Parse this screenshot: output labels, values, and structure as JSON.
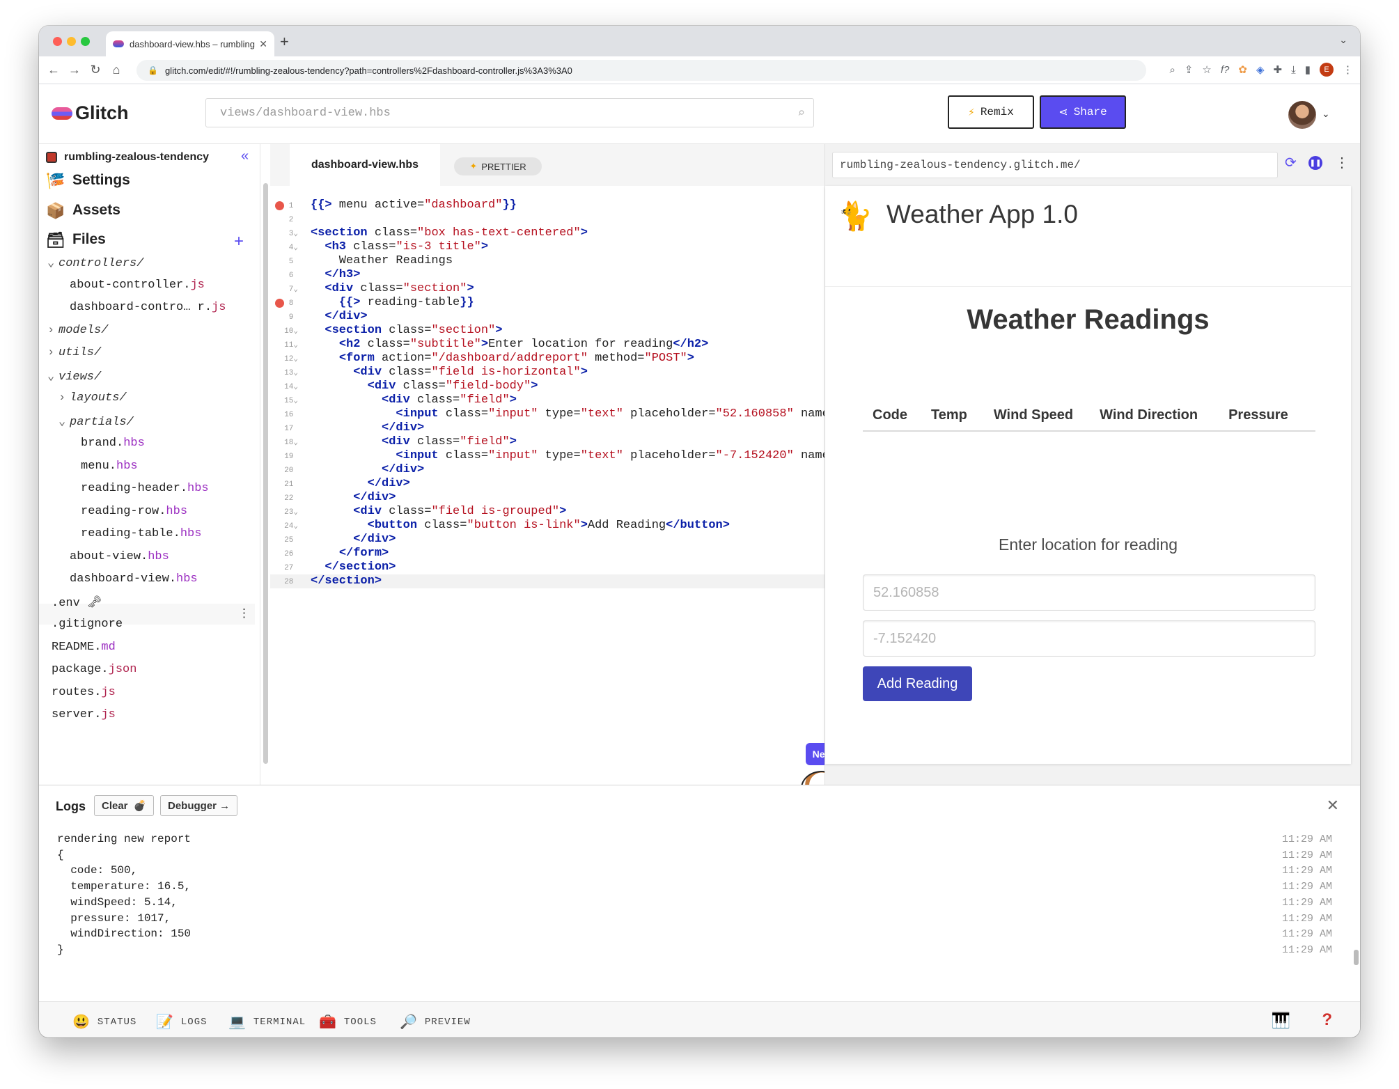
{
  "browser": {
    "tab_title": "dashboard-view.hbs – rumbling-zealous-tendency",
    "url": "glitch.com/edit/#!/rumbling-zealous-tendency?path=controllers%2Fdashboard-controller.js%3A3%3A0",
    "profile_initial": "E"
  },
  "header": {
    "logo": "Glitch",
    "search_placeholder": "views/dashboard-view.hbs",
    "remix_label": "Remix",
    "share_label": "Share"
  },
  "sidebar": {
    "project": "rumbling-zealous-tendency",
    "nav": [
      "Settings",
      "Assets",
      "Files"
    ],
    "files": [
      {
        "indent": 0,
        "type": "dir",
        "open": true,
        "name": "controllers/",
        "ext": ""
      },
      {
        "indent": 1,
        "type": "file",
        "name": "about-controller.",
        "ext": "js"
      },
      {
        "indent": 1,
        "type": "file",
        "name": "dashboard-contro… r.",
        "ext": "js"
      },
      {
        "indent": 0,
        "type": "dir",
        "open": false,
        "name": "models/",
        "ext": ""
      },
      {
        "indent": 0,
        "type": "dir",
        "open": false,
        "name": "utils/",
        "ext": ""
      },
      {
        "indent": 0,
        "type": "dir",
        "open": true,
        "name": "views/",
        "ext": ""
      },
      {
        "indent": 1,
        "type": "dir",
        "open": false,
        "name": "layouts/",
        "ext": ""
      },
      {
        "indent": 1,
        "type": "dir",
        "open": true,
        "name": "partials/",
        "ext": ""
      },
      {
        "indent": 2,
        "type": "file",
        "name": "brand.",
        "ext": "hbs"
      },
      {
        "indent": 2,
        "type": "file",
        "name": "menu.",
        "ext": "hbs"
      },
      {
        "indent": 2,
        "type": "file",
        "name": "reading-header.",
        "ext": "hbs"
      },
      {
        "indent": 2,
        "type": "file",
        "name": "reading-row.",
        "ext": "hbs"
      },
      {
        "indent": 2,
        "type": "file",
        "name": "reading-table.",
        "ext": "hbs"
      },
      {
        "indent": 1,
        "type": "file",
        "name": "about-view.",
        "ext": "hbs"
      },
      {
        "indent": 1,
        "type": "file",
        "name": "dashboard-view.",
        "ext": "hbs"
      },
      {
        "indent": -1,
        "type": "file",
        "name": ".env 🗝",
        "ext": ""
      },
      {
        "indent": -1,
        "type": "file",
        "name": ".gitignore",
        "ext": ""
      },
      {
        "indent": -1,
        "type": "file",
        "name": "README.",
        "ext": "md"
      },
      {
        "indent": -1,
        "type": "file",
        "name": "package.",
        "ext": "json"
      },
      {
        "indent": -1,
        "type": "file",
        "name": "routes.",
        "ext": "js"
      },
      {
        "indent": -1,
        "type": "file",
        "name": "server.",
        "ext": "js"
      }
    ]
  },
  "editor": {
    "tab": "dashboard-view.hbs",
    "prettier": "PRETTIER",
    "lines": [
      [
        [
          "h",
          "{{>"
        ],
        [
          "a",
          " menu active="
        ],
        [
          "s",
          "\"dashboard\""
        ],
        [
          "h",
          "}}"
        ]
      ],
      [],
      [
        [
          "t",
          "<section"
        ],
        [
          "a",
          " class="
        ],
        [
          "s",
          "\"box has-text-centered\""
        ],
        [
          "t",
          ">"
        ]
      ],
      [
        [
          "a",
          "  "
        ],
        [
          "t",
          "<h3"
        ],
        [
          "a",
          " class="
        ],
        [
          "s",
          "\"is-3 title\""
        ],
        [
          "t",
          ">"
        ]
      ],
      [
        [
          "a",
          "    Weather Readings"
        ]
      ],
      [
        [
          "a",
          "  "
        ],
        [
          "t",
          "</h3>"
        ]
      ],
      [
        [
          "a",
          "  "
        ],
        [
          "t",
          "<div"
        ],
        [
          "a",
          " class="
        ],
        [
          "s",
          "\"section\""
        ],
        [
          "t",
          ">"
        ]
      ],
      [
        [
          "a",
          "    "
        ],
        [
          "h",
          "{{>"
        ],
        [
          "a",
          " reading-table"
        ],
        [
          "h",
          "}}"
        ]
      ],
      [
        [
          "a",
          "  "
        ],
        [
          "t",
          "</div>"
        ]
      ],
      [
        [
          "a",
          "  "
        ],
        [
          "t",
          "<section"
        ],
        [
          "a",
          " class="
        ],
        [
          "s",
          "\"section\""
        ],
        [
          "t",
          ">"
        ]
      ],
      [
        [
          "a",
          "    "
        ],
        [
          "t",
          "<h2"
        ],
        [
          "a",
          " class="
        ],
        [
          "s",
          "\"subtitle\""
        ],
        [
          "t",
          ">"
        ],
        [
          "a",
          "Enter location for reading"
        ],
        [
          "t",
          "</h2>"
        ]
      ],
      [
        [
          "a",
          "    "
        ],
        [
          "t",
          "<form"
        ],
        [
          "a",
          " action="
        ],
        [
          "s",
          "\"/dashboard/addreport\""
        ],
        [
          "a",
          " method="
        ],
        [
          "s",
          "\"POST\""
        ],
        [
          "t",
          ">"
        ]
      ],
      [
        [
          "a",
          "      "
        ],
        [
          "t",
          "<div"
        ],
        [
          "a",
          " class="
        ],
        [
          "s",
          "\"field is-horizontal\""
        ],
        [
          "t",
          ">"
        ]
      ],
      [
        [
          "a",
          "        "
        ],
        [
          "t",
          "<div"
        ],
        [
          "a",
          " class="
        ],
        [
          "s",
          "\"field-body\""
        ],
        [
          "t",
          ">"
        ]
      ],
      [
        [
          "a",
          "          "
        ],
        [
          "t",
          "<div"
        ],
        [
          "a",
          " class="
        ],
        [
          "s",
          "\"field\""
        ],
        [
          "t",
          ">"
        ]
      ],
      [
        [
          "a",
          "            "
        ],
        [
          "t",
          "<input"
        ],
        [
          "a",
          " class="
        ],
        [
          "s",
          "\"input\""
        ],
        [
          "a",
          " type="
        ],
        [
          "s",
          "\"text\""
        ],
        [
          "a",
          " placeholder="
        ],
        [
          "s",
          "\"52.160858\""
        ],
        [
          "a",
          " name="
        ]
      ],
      [
        [
          "a",
          "          "
        ],
        [
          "t",
          "</div>"
        ]
      ],
      [
        [
          "a",
          "          "
        ],
        [
          "t",
          "<div"
        ],
        [
          "a",
          " class="
        ],
        [
          "s",
          "\"field\""
        ],
        [
          "t",
          ">"
        ]
      ],
      [
        [
          "a",
          "            "
        ],
        [
          "t",
          "<input"
        ],
        [
          "a",
          " class="
        ],
        [
          "s",
          "\"input\""
        ],
        [
          "a",
          " type="
        ],
        [
          "s",
          "\"text\""
        ],
        [
          "a",
          " placeholder="
        ],
        [
          "s",
          "\"-7.152420\""
        ],
        [
          "a",
          " name="
        ]
      ],
      [
        [
          "a",
          "          "
        ],
        [
          "t",
          "</div>"
        ]
      ],
      [
        [
          "a",
          "        "
        ],
        [
          "t",
          "</div>"
        ]
      ],
      [
        [
          "a",
          "      "
        ],
        [
          "t",
          "</div>"
        ]
      ],
      [
        [
          "a",
          "      "
        ],
        [
          "t",
          "<div"
        ],
        [
          "a",
          " class="
        ],
        [
          "s",
          "\"field is-grouped\""
        ],
        [
          "t",
          ">"
        ]
      ],
      [
        [
          "a",
          "        "
        ],
        [
          "t",
          "<button"
        ],
        [
          "a",
          " class="
        ],
        [
          "s",
          "\"button is-link\""
        ],
        [
          "t",
          ">"
        ],
        [
          "a",
          "Add Reading"
        ],
        [
          "t",
          "</button>"
        ]
      ],
      [
        [
          "a",
          "      "
        ],
        [
          "t",
          "</div>"
        ]
      ],
      [
        [
          "a",
          "    "
        ],
        [
          "t",
          "</form>"
        ]
      ],
      [
        [
          "a",
          "  "
        ],
        [
          "t",
          "</section>"
        ]
      ],
      [
        [
          "t",
          "</section>"
        ]
      ]
    ],
    "breakpoints": [
      1,
      8
    ],
    "folds": [
      3,
      4,
      7,
      10,
      11,
      12,
      13,
      14,
      15,
      18,
      23,
      24
    ],
    "current_line": 28,
    "new_badge": "New"
  },
  "preview": {
    "url": "rumbling-zealous-tendency.glitch.me/",
    "app_title": "Weather App 1.0",
    "heading": "Weather Readings",
    "columns": [
      "Code",
      "Temp",
      "Wind Speed",
      "Wind Direction",
      "Pressure"
    ],
    "subtitle": "Enter location for reading",
    "lat_placeholder": "52.160858",
    "lng_placeholder": "-7.152420",
    "button": "Add Reading"
  },
  "logs": {
    "title": "Logs",
    "clear": "Clear",
    "debugger": "Debugger →",
    "lines": [
      {
        "text": "rendering new report",
        "time": "11:29 AM"
      },
      {
        "text": "{",
        "time": "11:29 AM"
      },
      {
        "text": "  code: 500,",
        "time": "11:29 AM"
      },
      {
        "text": "  temperature: 16.5,",
        "time": "11:29 AM"
      },
      {
        "text": "  windSpeed: 5.14,",
        "time": "11:29 AM"
      },
      {
        "text": "  pressure: 1017,",
        "time": "11:29 AM"
      },
      {
        "text": "  windDirection: 150",
        "time": "11:29 AM"
      },
      {
        "text": "}",
        "time": "11:29 AM"
      }
    ]
  },
  "statusbar": {
    "items": [
      {
        "icon": "smiley-icon",
        "glyph": "😃",
        "label": "STATUS"
      },
      {
        "icon": "notepad-icon",
        "glyph": "📝",
        "label": "LOGS"
      },
      {
        "icon": "laptop-icon",
        "glyph": "💻",
        "label": "TERMINAL"
      },
      {
        "icon": "toolbox-icon",
        "glyph": "🧰",
        "label": "TOOLS"
      },
      {
        "icon": "magnifier-icon",
        "glyph": "🔎",
        "label": "PREVIEW"
      }
    ],
    "help": "?"
  },
  "colors": {
    "accent": "#5a4cf0",
    "preview_button": "#3e46b8",
    "breakpoint": "#e8564a"
  }
}
